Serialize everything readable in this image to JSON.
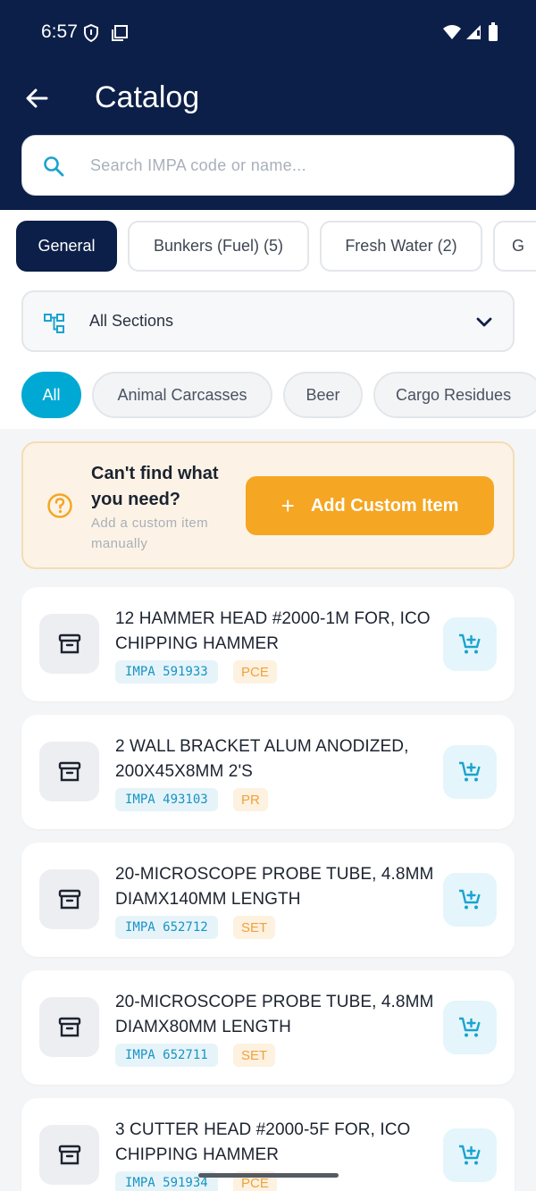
{
  "status_bar": {
    "time": "6:57"
  },
  "header": {
    "title": "Catalog"
  },
  "search": {
    "placeholder": "Search IMPA code or name..."
  },
  "category_tabs": [
    {
      "label": "General",
      "active": true
    },
    {
      "label": "Bunkers (Fuel) (5)",
      "active": false
    },
    {
      "label": "Fresh Water (2)",
      "active": false
    },
    {
      "label": "G",
      "active": false
    }
  ],
  "section_select": {
    "value": "All Sections"
  },
  "section_chips": [
    {
      "label": "All",
      "active": true
    },
    {
      "label": "Animal Carcasses",
      "active": false
    },
    {
      "label": "Beer",
      "active": false
    },
    {
      "label": "Cargo Residues",
      "active": false
    }
  ],
  "custom_item": {
    "title": "Can't find what you need?",
    "subtitle": "Add a custom item manually",
    "button_label": "Add Custom Item"
  },
  "items": [
    {
      "name": "12 HAMMER HEAD #2000-1M FOR, ICO CHIPPING HAMMER",
      "impa": "IMPA 591933",
      "unit": "PCE"
    },
    {
      "name": "2 WALL BRACKET ALUM ANODIZED, 200X45X8MM 2'S",
      "impa": "IMPA 493103",
      "unit": "PR"
    },
    {
      "name": "20-MICROSCOPE PROBE TUBE, 4.8MM DIAMX140MM LENGTH",
      "impa": "IMPA 652712",
      "unit": "SET"
    },
    {
      "name": "20-MICROSCOPE PROBE TUBE, 4.8MM DIAMX80MM LENGTH",
      "impa": "IMPA 652711",
      "unit": "SET"
    },
    {
      "name": "3 CUTTER HEAD #2000-5F FOR, ICO CHIPPING HAMMER",
      "impa": "IMPA 591934",
      "unit": "PCE"
    }
  ],
  "colors": {
    "header_bg": "#0c1f48",
    "accent_cyan": "#00a9d4",
    "accent_orange": "#f5a623"
  }
}
